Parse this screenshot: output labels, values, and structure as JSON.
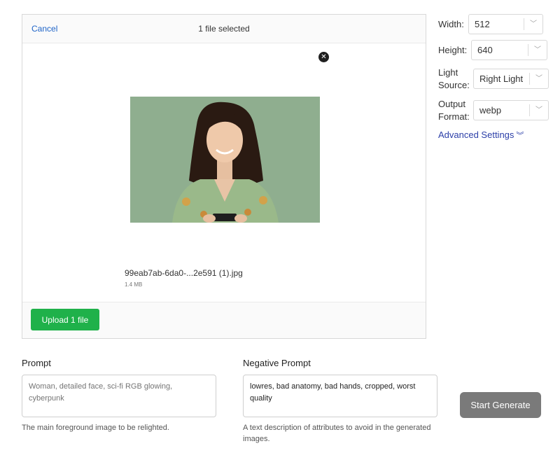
{
  "uploader": {
    "cancel_label": "Cancel",
    "selected_text": "1 file selected",
    "remove_icon": "close-icon",
    "file_name": "99eab7ab-6da0-...2e591 (1).jpg",
    "file_size": "1.4 MB",
    "upload_label": "Upload 1 file",
    "upload_color": "#1fb14a"
  },
  "settings": {
    "width": {
      "label": "Width:",
      "value": "512"
    },
    "height": {
      "label": "Height:",
      "value": "640"
    },
    "light_source": {
      "label_line1": "Light",
      "label_line2": "Source:",
      "value": "Right Light"
    },
    "output_format": {
      "label_line1": "Output",
      "label_line2": "Format:",
      "value": "webp"
    },
    "advanced_label": "Advanced Settings",
    "advanced_icon": "double-chevron-down-icon"
  },
  "prompt": {
    "label": "Prompt",
    "value": "",
    "placeholder": "Woman, detailed face, sci-fi RGB glowing, cyberpunk",
    "hint": "The main foreground image to be relighted."
  },
  "negative_prompt": {
    "label": "Negative Prompt",
    "value": "lowres, bad anatomy, bad hands, cropped, worst quality",
    "hint": "A text description of attributes to avoid in the generated images."
  },
  "start_label": "Start Generate",
  "colors": {
    "link": "#1f64c8",
    "accent_green": "#1fb14a",
    "disabled_button": "#7a7a7a"
  }
}
